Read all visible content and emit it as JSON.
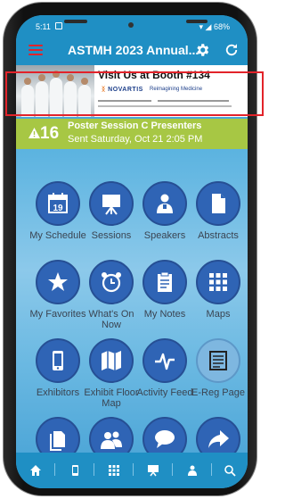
{
  "status_bar": {
    "time": "5:11",
    "battery": "68%"
  },
  "header": {
    "title": "ASTMH 2023 Annual..."
  },
  "banner": {
    "headline": "Visit Us at Booth #134",
    "brand": "NOVARTIS",
    "tagline": "Reimagining Medicine"
  },
  "notice": {
    "count": "16",
    "title": "Poster Session C Presenters",
    "subtitle": "Sent Saturday, Oct 21 2:05 PM"
  },
  "tiles": [
    {
      "label": "My Schedule",
      "icon": "calendar-icon"
    },
    {
      "label": "Sessions",
      "icon": "presentation-icon"
    },
    {
      "label": "Speakers",
      "icon": "speaker-icon"
    },
    {
      "label": "Abstracts",
      "icon": "document-icon"
    },
    {
      "label": "My Favorites",
      "icon": "star-icon"
    },
    {
      "label": "What's On Now",
      "icon": "alarm-clock-icon"
    },
    {
      "label": "My Notes",
      "icon": "clipboard-icon"
    },
    {
      "label": "Maps",
      "icon": "grid-icon"
    },
    {
      "label": "Exhibitors",
      "icon": "mobile-icon"
    },
    {
      "label": "Exhibit Floor Map",
      "icon": "map-icon"
    },
    {
      "label": "Activity Feed",
      "icon": "pulse-icon"
    },
    {
      "label": "E-Reg Page",
      "icon": "newspaper-icon"
    },
    {
      "label": "",
      "icon": "documents-icon"
    },
    {
      "label": "",
      "icon": "people-icon"
    },
    {
      "label": "",
      "icon": "chat-icon"
    },
    {
      "label": "",
      "icon": "share-icon"
    }
  ],
  "colors": {
    "accent": "#1f8fc4",
    "tile": "#2f64b5",
    "notice": "#a7c744",
    "menu": "#e2232a"
  }
}
